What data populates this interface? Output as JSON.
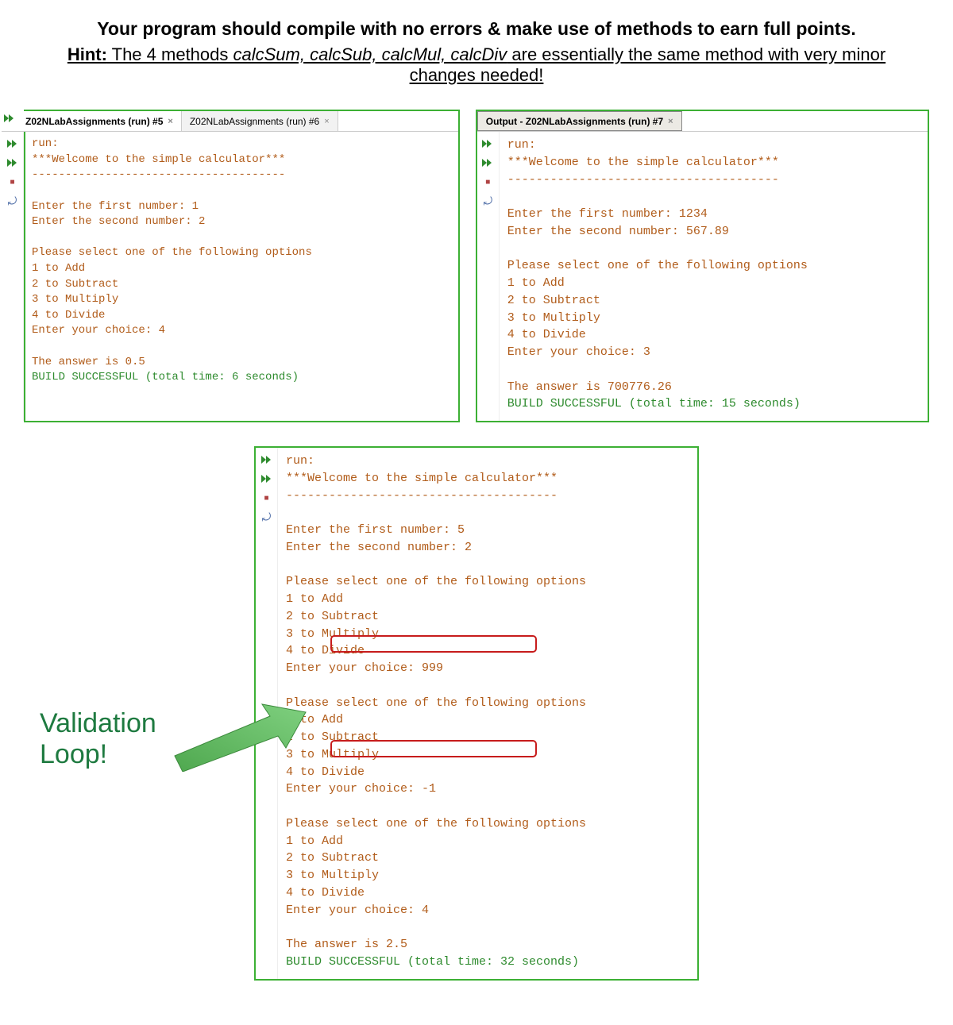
{
  "header": {
    "title_line1": "Your program should compile with no errors & make use of methods to earn full points.",
    "hint_label": "Hint:",
    "hint_pre": " The 4 methods ",
    "hint_methods": "calcSum, calcSub, calcMul, calcDiv",
    "hint_post": " are essentially the same method with very minor changes needed!"
  },
  "left_panel": {
    "tabs": [
      {
        "label": "Z02NLabAssignments (run) #5",
        "active": true
      },
      {
        "label": "Z02NLabAssignments (run) #6",
        "active": false
      }
    ],
    "output": "run:\n***Welcome to the simple calculator***\n--------------------------------------\n\nEnter the first number: 1\nEnter the second number: 2\n\nPlease select one of the following options\n1 to Add\n2 to Subtract\n3 to Multiply\n4 to Divide\nEnter your choice: 4\n\nThe answer is 0.5\n",
    "build": "BUILD SUCCESSFUL (total time: 6 seconds)"
  },
  "right_panel": {
    "tab": {
      "label": "Output - Z02NLabAssignments (run) #7"
    },
    "output": "run:\n***Welcome to the simple calculator***\n--------------------------------------\n\nEnter the first number: 1234\nEnter the second number: 567.89\n\nPlease select one of the following options\n1 to Add\n2 to Subtract\n3 to Multiply\n4 to Divide\nEnter your choice: 3\n\nThe answer is 700776.26\n",
    "build": "BUILD SUCCESSFUL (total time: 15 seconds)"
  },
  "bottom_panel": {
    "output": "run:\n***Welcome to the simple calculator***\n--------------------------------------\n\nEnter the first number: 5\nEnter the second number: 2\n\nPlease select one of the following options\n1 to Add\n2 to Subtract\n3 to Multiply\n4 to Divide\nEnter your choice: 999\n\nPlease select one of the following options\n1 to Add\n2 to Subtract\n3 to Multiply\n4 to Divide\nEnter your choice: -1\n\nPlease select one of the following options\n1 to Add\n2 to Subtract\n3 to Multiply\n4 to Divide\nEnter your choice: 4\n\nThe answer is 2.5\n",
    "build": "BUILD SUCCESSFUL (total time: 32 seconds)"
  },
  "validation_label": "Validation\nLoop!",
  "icons": {
    "close": "×",
    "stop": "■",
    "wrap": "⤾"
  }
}
